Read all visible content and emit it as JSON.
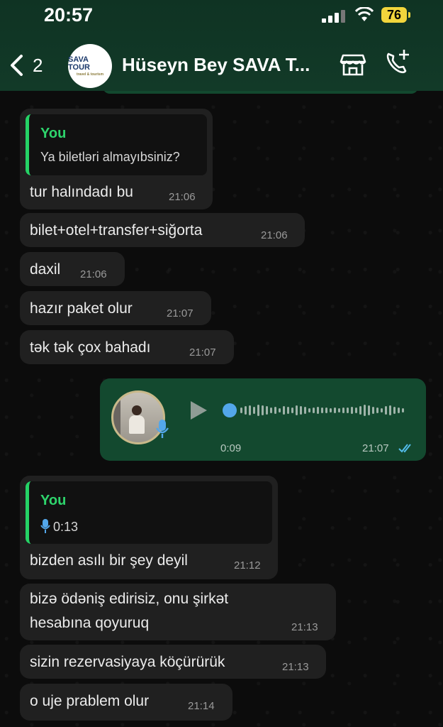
{
  "status_bar": {
    "time": "20:57",
    "battery": "76"
  },
  "header": {
    "back_count": "2",
    "avatar_text": "SAVA TOUR",
    "avatar_subtext": "travel & tourism",
    "contact_name": "Hüseyn Bey SAVA T..."
  },
  "messages": [
    {
      "quote_author": "You",
      "quote_text": "Ya biletləri almayıbsiniz?",
      "text": "tur halındadı bu",
      "time": "21:06"
    },
    {
      "text": "bilet+otel+transfer+siğorta",
      "time": "21:06"
    },
    {
      "text": "daxil",
      "time": "21:06"
    },
    {
      "text": "hazır paket olur",
      "time": "21:07"
    },
    {
      "text": "tək tək çox bahadı",
      "time": "21:07"
    }
  ],
  "voice_message": {
    "duration": "0:09",
    "time": "21:07"
  },
  "messages2": [
    {
      "quote_author": "You",
      "quote_voice_duration": "0:13",
      "text": "bizden asılı bir şey deyil",
      "time": "21:12"
    },
    {
      "text_line1": "bizə ödəniş edirisiz, onu şirkət",
      "text_line2": "hesabına qoyuruq",
      "time": "21:13"
    },
    {
      "text": "sizin rezervasiyaya köçürürük",
      "time": "21:13"
    },
    {
      "text": "o uje prablem olur",
      "time": "21:14"
    }
  ],
  "colors": {
    "outgoing_bubble": "#13492f",
    "incoming_bubble": "#202020",
    "quote_accent": "#25d366",
    "read_ticks": "#53bdeb"
  },
  "icons": [
    "back-chevron-icon",
    "shop-icon",
    "add-call-icon",
    "play-icon",
    "microphone-icon",
    "double-check-icon"
  ]
}
